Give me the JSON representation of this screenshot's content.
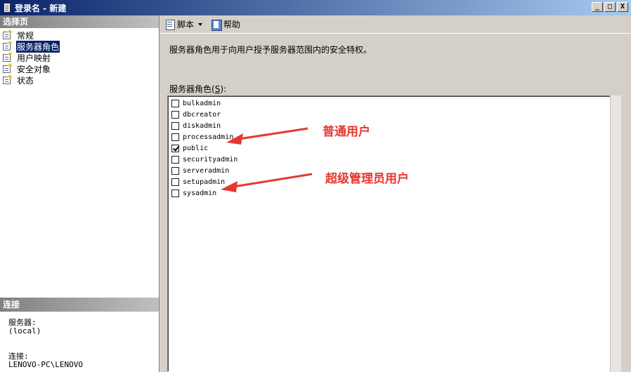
{
  "window": {
    "title": "登录名 - 新建",
    "buttons": {
      "minimize": "_",
      "maximize": "□",
      "close": "X"
    }
  },
  "left_panel": {
    "select_page_header": "选择页",
    "nav_items": [
      {
        "label": "常规",
        "icon": "page-settings-icon",
        "selected": false
      },
      {
        "label": "服务器角色",
        "icon": "page-settings-icon",
        "selected": true
      },
      {
        "label": "用户映射",
        "icon": "page-settings-icon",
        "selected": false
      },
      {
        "label": "安全对象",
        "icon": "page-settings-icon",
        "selected": false
      },
      {
        "label": "状态",
        "icon": "page-settings-icon",
        "selected": false
      }
    ],
    "connection_header": "连接",
    "server_label": "服务器:",
    "server_value": "(local)",
    "connection_label": "连接:",
    "connection_value": "LENOVO-PC\\LENOVO"
  },
  "toolbar": {
    "script_label": "脚本",
    "script_icon": "script-icon",
    "help_label": "帮助",
    "help_icon": "help-icon"
  },
  "main": {
    "description": "服务器角色用于向用户授予服务器范围内的安全特权。",
    "roles_label": "服务器角色",
    "roles_accesskey": "S",
    "roles": [
      {
        "name": "bulkadmin",
        "checked": false
      },
      {
        "name": "dbcreator",
        "checked": false
      },
      {
        "name": "diskadmin",
        "checked": false
      },
      {
        "name": "processadmin",
        "checked": false
      },
      {
        "name": "public",
        "checked": true
      },
      {
        "name": "securityadmin",
        "checked": false
      },
      {
        "name": "serveradmin",
        "checked": false
      },
      {
        "name": "setupadmin",
        "checked": false
      },
      {
        "name": "sysadmin",
        "checked": false
      }
    ]
  },
  "annotations": {
    "normal_user": "普通用户",
    "super_admin": "超级管理员用户",
    "color": "#e8372f"
  }
}
